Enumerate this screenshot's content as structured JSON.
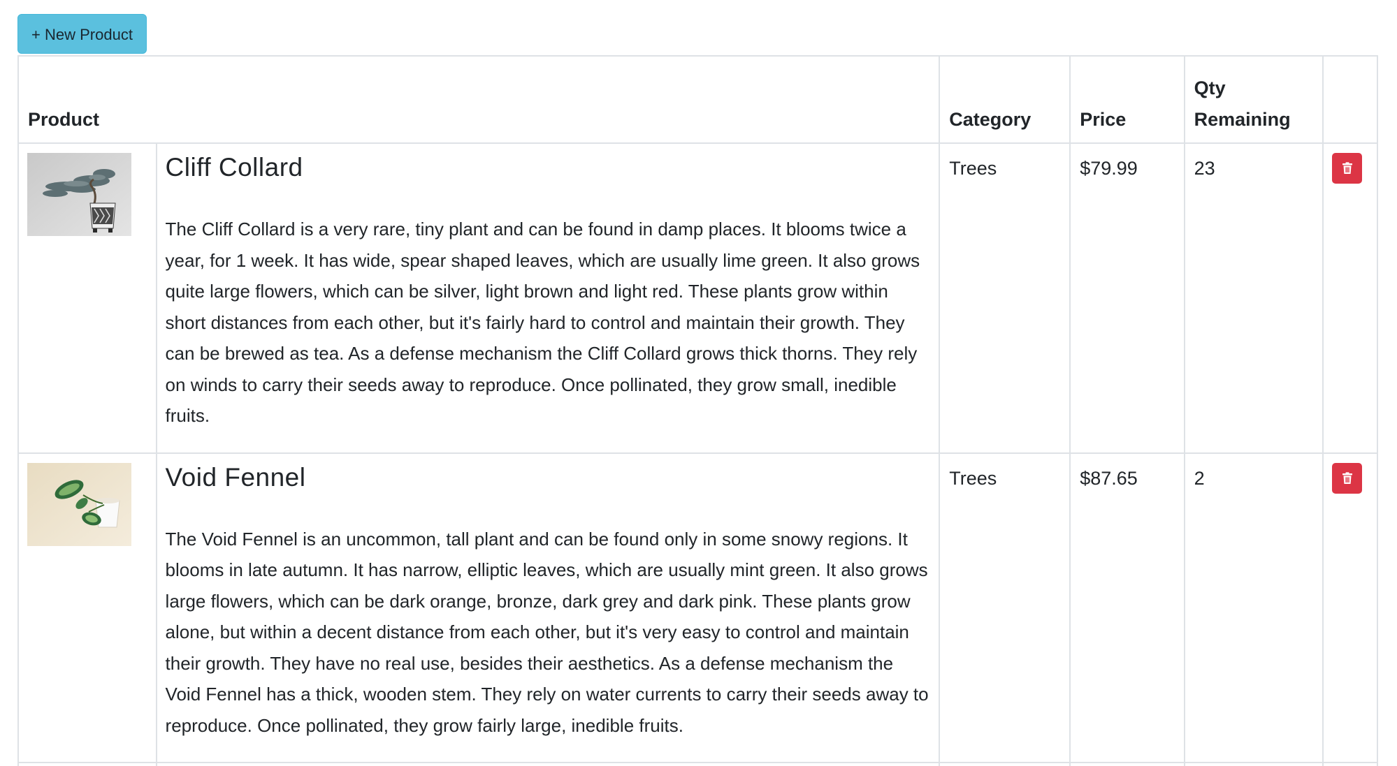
{
  "toolbar": {
    "new_product_label": "+ New Product"
  },
  "table": {
    "headers": {
      "product": "Product",
      "category": "Category",
      "price": "Price",
      "qty_line1": "Qty",
      "qty_line2": "Remaining"
    },
    "rows": [
      {
        "name": "Cliff Collard",
        "description": "The Cliff Collard is a very rare, tiny plant and can be found in damp places. It blooms twice a year, for 1 week. It has wide, spear shaped leaves, which are usually lime green. It also grows quite large flowers, which can be silver, light brown and light red. These plants grow within short distances from each other, but it's fairly hard to control and maintain their growth. They can be brewed as tea. As a defense mechanism the Cliff Collard grows thick thorns. They rely on winds to carry their seeds away to reproduce. Once pollinated, they grow small, inedible fruits.",
        "category": "Trees",
        "price": "$79.99",
        "qty": "23",
        "image": "bonsai-tree-in-patterned-pot"
      },
      {
        "name": "Void Fennel",
        "description": "The Void Fennel is an uncommon, tall plant and can be found only in some snowy regions. It blooms in late autumn. It has narrow, elliptic leaves, which are usually mint green. It also grows large flowers, which can be dark orange, bronze, dark grey and dark pink. These plants grow alone, but within a decent distance from each other, but it's very easy to control and maintain their growth. They have no real use, besides their aesthetics. As a defense mechanism the Void Fennel has a thick, wooden stem. They rely on water currents to carry their seeds away to reproduce. Once pollinated, they grow fairly large, inedible fruits.",
        "category": "Trees",
        "price": "$87.65",
        "qty": "2",
        "image": "variegated-plant-in-white-cup"
      }
    ]
  },
  "icons": {
    "delete": "trash-icon"
  },
  "colors": {
    "new_button_bg": "#5bc0de",
    "delete_button_bg": "#dc3545",
    "border": "#dee2e6"
  }
}
